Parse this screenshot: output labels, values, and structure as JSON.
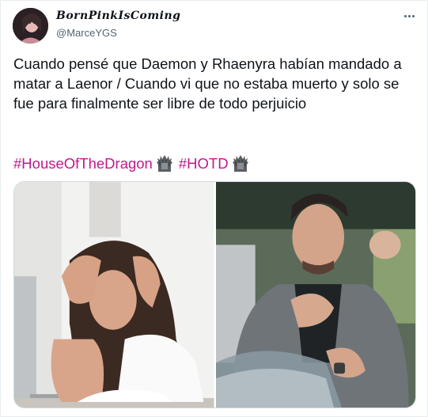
{
  "tweet": {
    "display_name": "BornPinkIsComing",
    "handle": "@MarceYGS",
    "text": "Cuando pensé que Daemon y Rhaenyra habían mandado a matar a Laenor / Cuando vi que no estaba muerto y solo se fue para finalmente ser libre de todo perjuicio",
    "hashtags": [
      "#HouseOfTheDragon",
      "#HOTD"
    ],
    "hashtag_emoji": "throne-icon"
  },
  "colors": {
    "hashtag": "#c5168b",
    "text": "#0f1419",
    "secondary": "#536471",
    "border": "#cfd9de"
  },
  "media": {
    "count": 2,
    "items": [
      {
        "subject": "stressed woman at laptop"
      },
      {
        "subject": "man relieved with hand on chest"
      }
    ]
  }
}
